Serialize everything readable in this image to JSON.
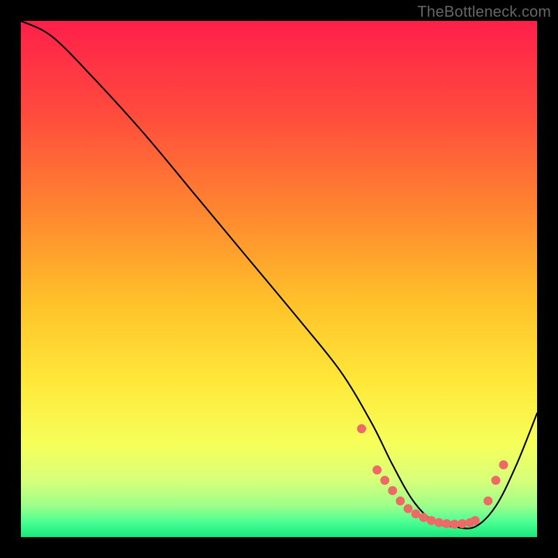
{
  "watermark": "TheBottleneck.com",
  "chart_data": {
    "type": "line",
    "title": "",
    "xlabel": "",
    "ylabel": "",
    "xlim": [
      0,
      100
    ],
    "ylim": [
      0,
      100
    ],
    "gradient_stops": [
      {
        "offset": 0,
        "color": "#ff1f4b"
      },
      {
        "offset": 18,
        "color": "#ff4b3d"
      },
      {
        "offset": 38,
        "color": "#ff8a2f"
      },
      {
        "offset": 55,
        "color": "#ffc32a"
      },
      {
        "offset": 70,
        "color": "#ffe83a"
      },
      {
        "offset": 82,
        "color": "#f6ff5a"
      },
      {
        "offset": 89,
        "color": "#d8ff7a"
      },
      {
        "offset": 94,
        "color": "#9cff8a"
      },
      {
        "offset": 97,
        "color": "#4dff94"
      },
      {
        "offset": 100,
        "color": "#17e879"
      }
    ],
    "series": [
      {
        "name": "bottleneck-curve",
        "x": [
          0,
          6,
          14,
          24,
          34,
          44,
          54,
          62,
          68,
          72,
          76,
          80,
          84,
          88,
          92,
          96,
          100
        ],
        "y": [
          100,
          97,
          89,
          78,
          66,
          54,
          42,
          32,
          22,
          14,
          7,
          3,
          2,
          2,
          6,
          14,
          24
        ]
      }
    ],
    "scatter": {
      "name": "highlight-dots",
      "x": [
        66,
        69,
        70.5,
        72,
        73.5,
        75,
        76.5,
        78,
        79.5,
        81,
        82.5,
        84,
        85.5,
        87,
        88,
        90.5,
        92,
        93.5
      ],
      "y": [
        21,
        13,
        11,
        9,
        7,
        5.5,
        4.5,
        3.8,
        3.2,
        2.8,
        2.6,
        2.5,
        2.6,
        2.8,
        3.2,
        7,
        11,
        14
      ]
    }
  }
}
